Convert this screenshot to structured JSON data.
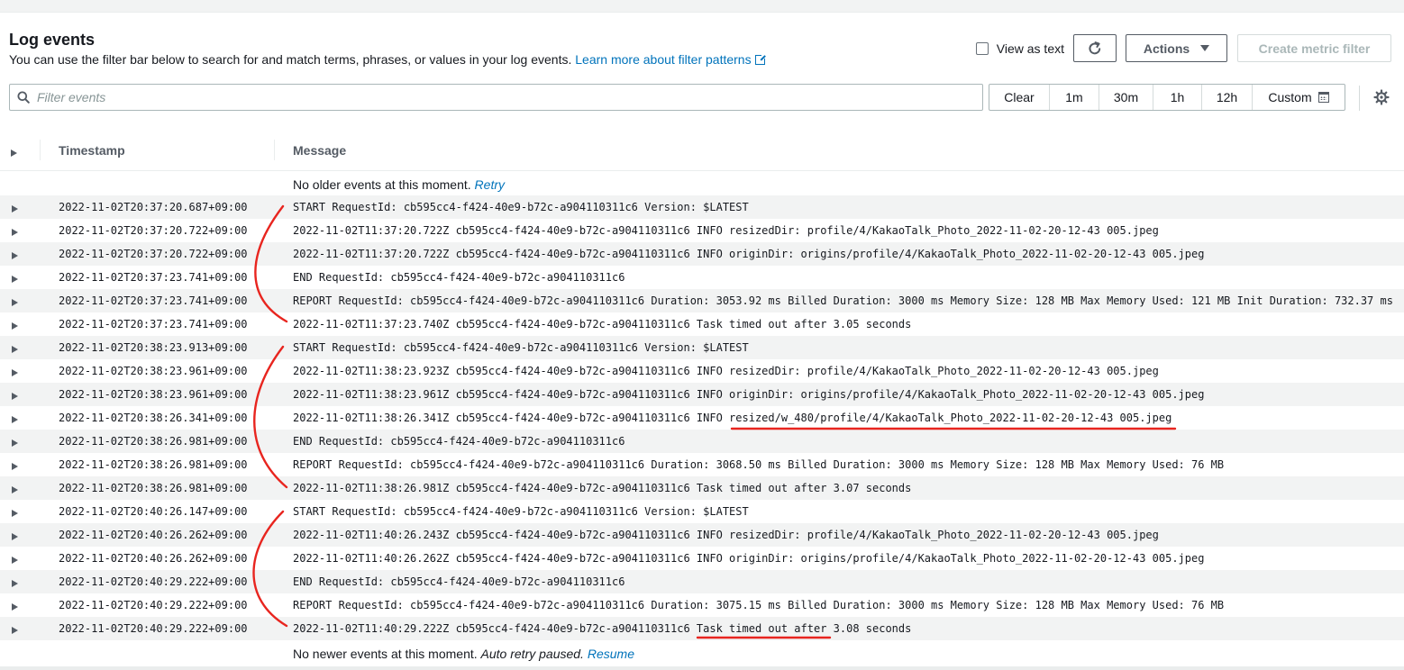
{
  "header": {
    "title": "Log events",
    "description": "You can use the filter bar below to search for and match terms, phrases, or values in your log events.",
    "learn_more": "Learn more about filter patterns"
  },
  "controls": {
    "view_as_text": "View as text",
    "actions": "Actions",
    "create_metric_filter": "Create metric filter"
  },
  "filter": {
    "placeholder": "Filter events",
    "ranges": [
      "Clear",
      "1m",
      "30m",
      "1h",
      "12h",
      "Custom"
    ]
  },
  "table": {
    "col_timestamp": "Timestamp",
    "col_message": "Message",
    "top_notice": "No older events at this moment.",
    "top_link": "Retry",
    "bottom_notice": "No newer events at this moment.",
    "bottom_italic": "Auto retry paused.",
    "bottom_link": "Resume",
    "rows": [
      {
        "ts": "2022-11-02T20:37:20.687+09:00",
        "msg": "START RequestId: cb595cc4-f424-40e9-b72c-a904110311c6 Version: $LATEST"
      },
      {
        "ts": "2022-11-02T20:37:20.722+09:00",
        "msg": "2022-11-02T11:37:20.722Z cb595cc4-f424-40e9-b72c-a904110311c6 INFO resizedDir: profile/4/KakaoTalk_Photo_2022-11-02-20-12-43 005.jpeg"
      },
      {
        "ts": "2022-11-02T20:37:20.722+09:00",
        "msg": "2022-11-02T11:37:20.722Z cb595cc4-f424-40e9-b72c-a904110311c6 INFO originDir: origins/profile/4/KakaoTalk_Photo_2022-11-02-20-12-43 005.jpeg"
      },
      {
        "ts": "2022-11-02T20:37:23.741+09:00",
        "msg": "END RequestId: cb595cc4-f424-40e9-b72c-a904110311c6"
      },
      {
        "ts": "2022-11-02T20:37:23.741+09:00",
        "msg": "REPORT RequestId: cb595cc4-f424-40e9-b72c-a904110311c6 Duration: 3053.92 ms Billed Duration: 3000 ms Memory Size: 128 MB Max Memory Used: 121 MB Init Duration: 732.37 ms"
      },
      {
        "ts": "2022-11-02T20:37:23.741+09:00",
        "msg": "2022-11-02T11:37:23.740Z cb595cc4-f424-40e9-b72c-a904110311c6 Task timed out after 3.05 seconds"
      },
      {
        "ts": "2022-11-02T20:38:23.913+09:00",
        "msg": "START RequestId: cb595cc4-f424-40e9-b72c-a904110311c6 Version: $LATEST"
      },
      {
        "ts": "2022-11-02T20:38:23.961+09:00",
        "msg": "2022-11-02T11:38:23.923Z cb595cc4-f424-40e9-b72c-a904110311c6 INFO resizedDir: profile/4/KakaoTalk_Photo_2022-11-02-20-12-43 005.jpeg"
      },
      {
        "ts": "2022-11-02T20:38:23.961+09:00",
        "msg": "2022-11-02T11:38:23.961Z cb595cc4-f424-40e9-b72c-a904110311c6 INFO originDir: origins/profile/4/KakaoTalk_Photo_2022-11-02-20-12-43 005.jpeg"
      },
      {
        "ts": "2022-11-02T20:38:26.341+09:00",
        "msg": "2022-11-02T11:38:26.341Z cb595cc4-f424-40e9-b72c-a904110311c6 INFO resized/w_480/profile/4/KakaoTalk_Photo_2022-11-02-20-12-43 005.jpeg"
      },
      {
        "ts": "2022-11-02T20:38:26.981+09:00",
        "msg": "END RequestId: cb595cc4-f424-40e9-b72c-a904110311c6"
      },
      {
        "ts": "2022-11-02T20:38:26.981+09:00",
        "msg": "REPORT RequestId: cb595cc4-f424-40e9-b72c-a904110311c6 Duration: 3068.50 ms Billed Duration: 3000 ms Memory Size: 128 MB Max Memory Used: 76 MB"
      },
      {
        "ts": "2022-11-02T20:38:26.981+09:00",
        "msg": "2022-11-02T11:38:26.981Z cb595cc4-f424-40e9-b72c-a904110311c6 Task timed out after 3.07 seconds"
      },
      {
        "ts": "2022-11-02T20:40:26.147+09:00",
        "msg": "START RequestId: cb595cc4-f424-40e9-b72c-a904110311c6 Version: $LATEST"
      },
      {
        "ts": "2022-11-02T20:40:26.262+09:00",
        "msg": "2022-11-02T11:40:26.243Z cb595cc4-f424-40e9-b72c-a904110311c6 INFO resizedDir: profile/4/KakaoTalk_Photo_2022-11-02-20-12-43 005.jpeg"
      },
      {
        "ts": "2022-11-02T20:40:26.262+09:00",
        "msg": "2022-11-02T11:40:26.262Z cb595cc4-f424-40e9-b72c-a904110311c6 INFO originDir: origins/profile/4/KakaoTalk_Photo_2022-11-02-20-12-43 005.jpeg"
      },
      {
        "ts": "2022-11-02T20:40:29.222+09:00",
        "msg": "END RequestId: cb595cc4-f424-40e9-b72c-a904110311c6"
      },
      {
        "ts": "2022-11-02T20:40:29.222+09:00",
        "msg": "REPORT RequestId: cb595cc4-f424-40e9-b72c-a904110311c6 Duration: 3075.15 ms Billed Duration: 3000 ms Memory Size: 128 MB Max Memory Used: 76 MB"
      },
      {
        "ts": "2022-11-02T20:40:29.222+09:00",
        "msg": "2022-11-02T11:40:29.222Z cb595cc4-f424-40e9-b72c-a904110311c6 Task timed out after 3.08 seconds"
      }
    ]
  },
  "colors": {
    "link": "#0073bb",
    "annotation": "#e8251f",
    "row_stripe": "#f2f3f3"
  }
}
